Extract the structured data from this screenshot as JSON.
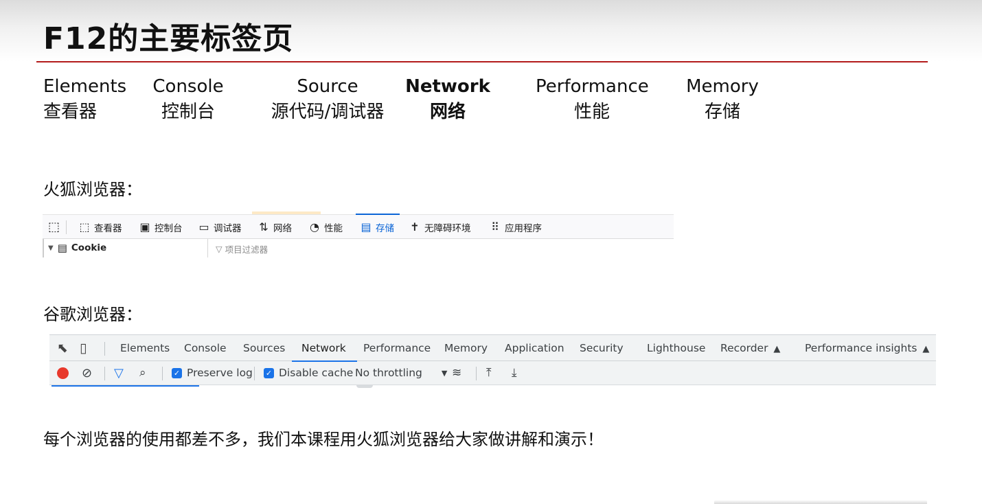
{
  "title": "F12的主要标签页",
  "tabs": [
    {
      "en": "Elements",
      "zh": "查看器"
    },
    {
      "en": "Console",
      "zh": "控制台"
    },
    {
      "en": "Source",
      "zh": "源代码/调试器"
    },
    {
      "en": "Network",
      "zh": "网络"
    },
    {
      "en": "Performance",
      "zh": "性能"
    },
    {
      "en": "Memory",
      "zh": "存储"
    }
  ],
  "firefox": {
    "label": "火狐浏览器：",
    "tabs": [
      {
        "label": "查看器",
        "icon": "inspector-icon"
      },
      {
        "label": "控制台",
        "icon": "console-icon"
      },
      {
        "label": "调试器",
        "icon": "debugger-icon"
      },
      {
        "label": "网络",
        "icon": "network-icon"
      },
      {
        "label": "性能",
        "icon": "performance-icon"
      },
      {
        "label": "存储",
        "icon": "storage-icon"
      },
      {
        "label": "无障碍环境",
        "icon": "accessibility-icon"
      },
      {
        "label": "应用程序",
        "icon": "application-icon"
      }
    ],
    "active_tab": "存储",
    "tree_item": "Cookie",
    "filter_placeholder": "项目过滤器"
  },
  "chrome": {
    "label": "谷歌浏览器：",
    "tabs": [
      "Elements",
      "Console",
      "Sources",
      "Network",
      "Performance",
      "Memory",
      "Application",
      "Security",
      "Lighthouse",
      "Recorder",
      "Performance insights"
    ],
    "active_tab": "Network",
    "toolbar": {
      "preserve_log": "Preserve log",
      "disable_cache": "Disable cache",
      "throttling": "No throttling"
    }
  },
  "footer_text": "每个浏览器的使用都差不多，我们本课程用火狐浏览器给大家做讲解和演示！"
}
